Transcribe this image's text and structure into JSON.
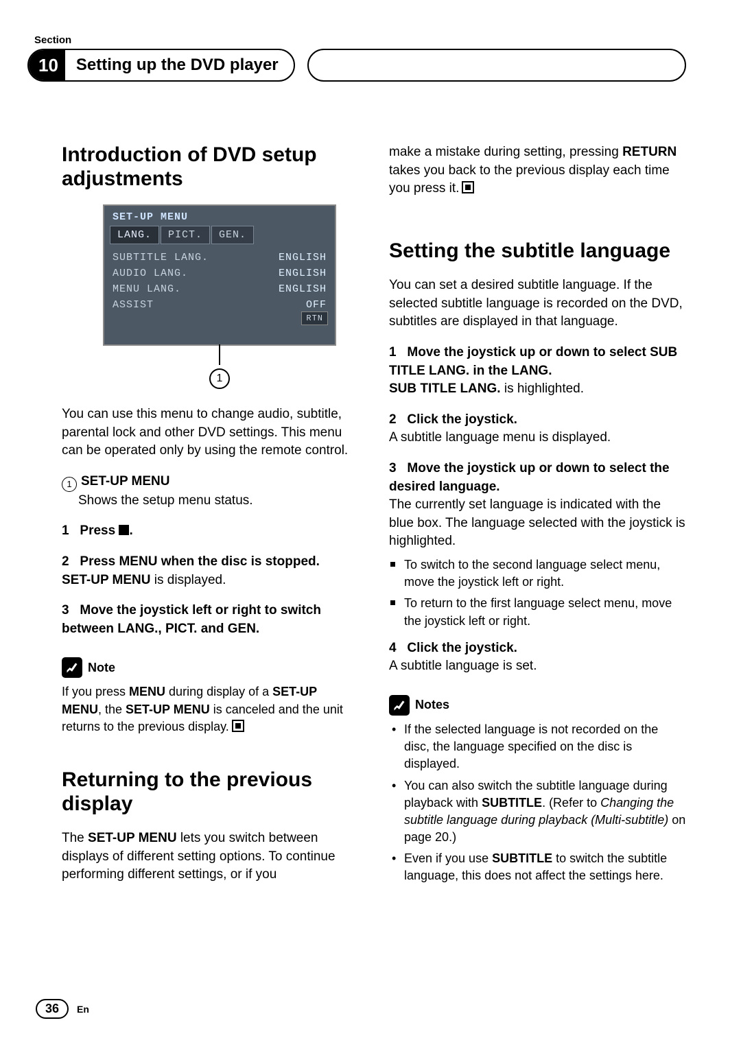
{
  "section_label": "Section",
  "section_number": "10",
  "section_title": "Setting up the DVD player",
  "h_intro": "Introduction of DVD setup adjustments",
  "menu": {
    "title": "SET-UP MENU",
    "tabs": [
      "LANG.",
      "PICT.",
      "GEN."
    ],
    "rows": [
      {
        "l": "SUBTITLE LANG.",
        "r": "ENGLISH"
      },
      {
        "l": "AUDIO LANG.",
        "r": "ENGLISH"
      },
      {
        "l": "MENU LANG.",
        "r": "ENGLISH"
      },
      {
        "l": "ASSIST",
        "r": "OFF"
      }
    ],
    "rtn": "RTN"
  },
  "callout1": "1",
  "intro_p": "You can use this menu to change audio, subtitle, parental lock and other DVD settings. This menu can be operated only by using the remote control.",
  "setup_label": "SET-UP MENU",
  "setup_desc": "Shows the setup menu status.",
  "s1_num": "1",
  "s1_bold": "Press ",
  "s1_tail": ".",
  "s2_num": "2",
  "s2_bold": "Press MENU when the disc is stopped.",
  "s2_line2a": "SET-UP MENU",
  "s2_line2b": " is displayed.",
  "s3_num": "3",
  "s3_bold": "Move the joystick left or right to switch between LANG., PICT. and GEN.",
  "note_label": "Note",
  "note_text_a": "If you press ",
  "note_text_b": "MENU",
  "note_text_c": " during display of a ",
  "note_text_d": "SET-UP MENU",
  "note_text_e": ", the ",
  "note_text_f": "SET-UP MENU",
  "note_text_g": " is canceled and the unit returns to the previous display.",
  "h_return": "Returning to the previous display",
  "return_p1": "The ",
  "return_b": "SET-UP MENU",
  "return_p2": " lets you switch between displays of different setting options. To continue performing different settings, or if you",
  "col2_top": "make a mistake during setting, pressing ",
  "col2_top_b": "RETURN",
  "col2_top2": " takes you back to the previous display each time you press it.",
  "h_subtitle": "Setting the subtitle language",
  "sub_p": "You can set a desired subtitle language. If the selected subtitle language is recorded on the DVD, subtitles are displayed in that language.",
  "sub1_num": "1",
  "sub1_bold": "Move the joystick up or down to select SUB TITLE LANG. in the LANG.",
  "sub1_line2a": "SUB TITLE LANG.",
  "sub1_line2b": " is highlighted.",
  "sub2_num": "2",
  "sub2_bold": "Click the joystick.",
  "sub2_line2": "A subtitle language menu is displayed.",
  "sub3_num": "3",
  "sub3_bold": "Move the joystick up or down to select the desired language.",
  "sub3_p": "The currently set language is indicated with the blue box. The language selected with the joystick is highlighted.",
  "sub3_li1": "To switch to the second language select menu, move the joystick left or right.",
  "sub3_li2": "To return to the first language select menu, move the joystick left or right.",
  "sub4_num": "4",
  "sub4_bold": "Click the joystick.",
  "sub4_line2": "A subtitle language is set.",
  "notes_label": "Notes",
  "notes_li1": "If the selected language is not recorded on the disc, the language specified on the disc is displayed.",
  "notes_li2a": "You can also switch the subtitle language during playback with ",
  "notes_li2b": "SUBTITLE",
  "notes_li2c": ". (Refer to ",
  "notes_li2d": "Changing the subtitle language during playback (Multi-subtitle)",
  "notes_li2e": " on page 20.)",
  "notes_li3a": "Even if you use ",
  "notes_li3b": "SUBTITLE",
  "notes_li3c": " to switch the subtitle language, this does not affect the settings here.",
  "page_number": "36",
  "lang_code": "En"
}
